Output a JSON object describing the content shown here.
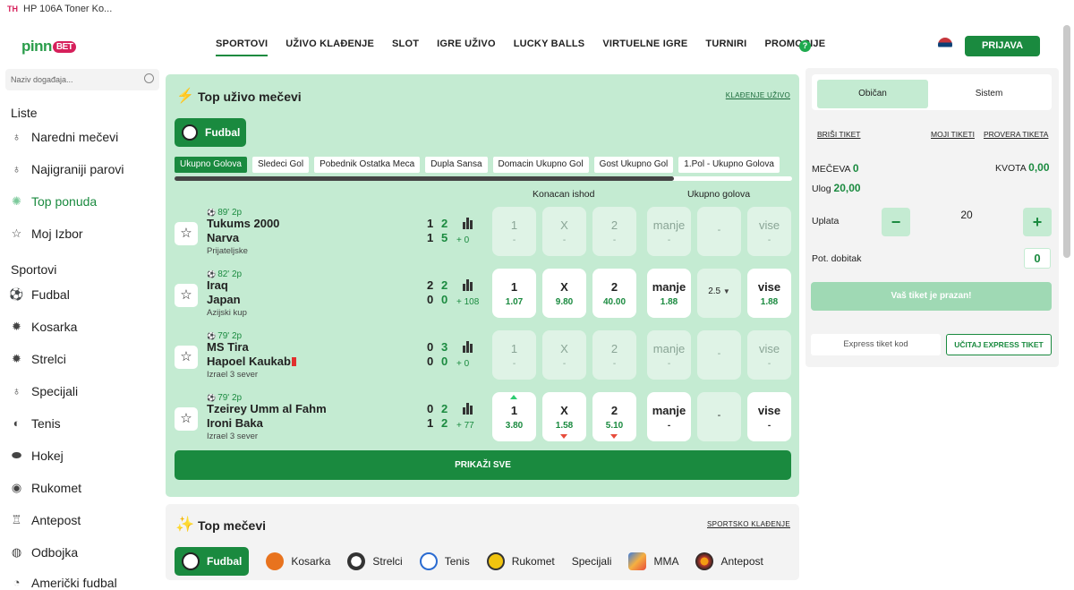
{
  "browser_tab": {
    "favicon": "TH",
    "title": "HP 106A Toner Ko..."
  },
  "header": {
    "logo_text": "pinn",
    "logo_badge": "BET",
    "nav": [
      "SPORTOVI",
      "UŽIVO KLAĐENJE",
      "SLOT",
      "IGRE UŽIVO",
      "LUCKY BALLS",
      "VIRTUELNE IGRE",
      "TURNIRI",
      "PROMOCIJE"
    ],
    "help_label": "?",
    "login_label": "PRIJAVA"
  },
  "sidebar": {
    "search_placeholder": "Naziv događaja...",
    "lists_heading": "Liste",
    "lists": [
      "Naredni mečevi",
      "Najigraniji parovi",
      "Top ponuda",
      "Moj Izbor"
    ],
    "sports_heading": "Sportovi",
    "sports": [
      "Fudbal",
      "Kosarka",
      "Strelci",
      "Specijali",
      "Tenis",
      "Hokej",
      "Rukomet",
      "Antepost",
      "Odbojka",
      "Američki fudbal"
    ]
  },
  "live": {
    "title": "Top uživo mečevi",
    "link": "KLAĐENJE UŽIVO",
    "sport_button": "Fudbal",
    "market_tabs": [
      "Ukupno Golova",
      "Sledeci Gol",
      "Pobednik Ostatka Meca",
      "Dupla Sansa",
      "Domacin Ukupno Gol",
      "Gost Ukupno Gol",
      "1.Pol - Ukupno Golova"
    ],
    "col_final": "Konacan ishod",
    "col_goals": "Ukupno golova",
    "matches": [
      {
        "minute": "89' 2p",
        "home": "Tukums 2000",
        "away": "Narva",
        "league": "Prijateljske",
        "sh1": "1",
        "sh2": "2",
        "sa1": "1",
        "sa2": "5",
        "plus": "+ 0",
        "o1": "1",
        "o1v": "-",
        "ox": "X",
        "oxv": "-",
        "o2": "2",
        "o2v": "-",
        "under": "manje",
        "underv": "-",
        "line": "-",
        "over": "vise",
        "overv": "-"
      },
      {
        "minute": "82' 2p",
        "home": "Iraq",
        "away": "Japan",
        "league": "Azijski kup",
        "sh1": "2",
        "sh2": "2",
        "sa1": "0",
        "sa2": "0",
        "plus": "+ 108",
        "o1": "1",
        "o1v": "1.07",
        "ox": "X",
        "oxv": "9.80",
        "o2": "2",
        "o2v": "40.00",
        "under": "manje",
        "underv": "1.88",
        "line": "2.5",
        "over": "vise",
        "overv": "1.88"
      },
      {
        "minute": "79' 2p",
        "home": "MS Tira",
        "away": "Hapoel Kaukab",
        "league": "Izrael 3 sever",
        "sh1": "0",
        "sh2": "3",
        "sa1": "0",
        "sa2": "0",
        "plus": "+ 0",
        "o1": "1",
        "o1v": "-",
        "ox": "X",
        "oxv": "-",
        "o2": "2",
        "o2v": "-",
        "under": "manje",
        "underv": "-",
        "line": "-",
        "over": "vise",
        "overv": "-"
      },
      {
        "minute": "79' 2p",
        "home": "Tzeirey Umm al Fahm",
        "away": "Ironi Baka",
        "league": "Izrael 3 sever",
        "sh1": "0",
        "sh2": "2",
        "sa1": "1",
        "sa2": "2",
        "plus": "+ 77",
        "o1": "1",
        "o1v": "3.80",
        "ox": "X",
        "oxv": "1.58",
        "o2": "2",
        "o2v": "5.10",
        "under": "manje",
        "underv": "-",
        "line": "-",
        "over": "vise",
        "overv": "-"
      }
    ],
    "show_all": "PRIKAŽI SVE"
  },
  "top": {
    "title": "Top mečevi",
    "link": "SPORTSKO KLAĐENJE",
    "sports": [
      "Fudbal",
      "Kosarka",
      "Strelci",
      "Tenis",
      "Rukomet",
      "Specijali",
      "MMA",
      "Antepost"
    ]
  },
  "ticket": {
    "tab_regular": "Običan",
    "tab_system": "Sistem",
    "clear": "BRIŠI TIKET",
    "my_tickets": "MOJI TIKETI",
    "check": "PROVERA TIKETA",
    "matches_label": "MEČEVA",
    "matches_value": "0",
    "odds_label": "KVOTA",
    "odds_value": "0,00",
    "stake_label": "Ulog",
    "stake_value": "20,00",
    "payment_label": "Uplata",
    "amount": "20",
    "minus": "−",
    "plus": "+",
    "potential_label": "Pot. dobitak",
    "potential_value": "0",
    "empty_label": "Vaš tiket je prazan!",
    "express_placeholder": "Express tiket kod",
    "express_button": "UČITAJ EXPRESS TIKET"
  },
  "colors": {
    "brand_green": "#1a8a3f",
    "light_green": "#c4ebd2",
    "accent_pink": "#d6205b"
  }
}
